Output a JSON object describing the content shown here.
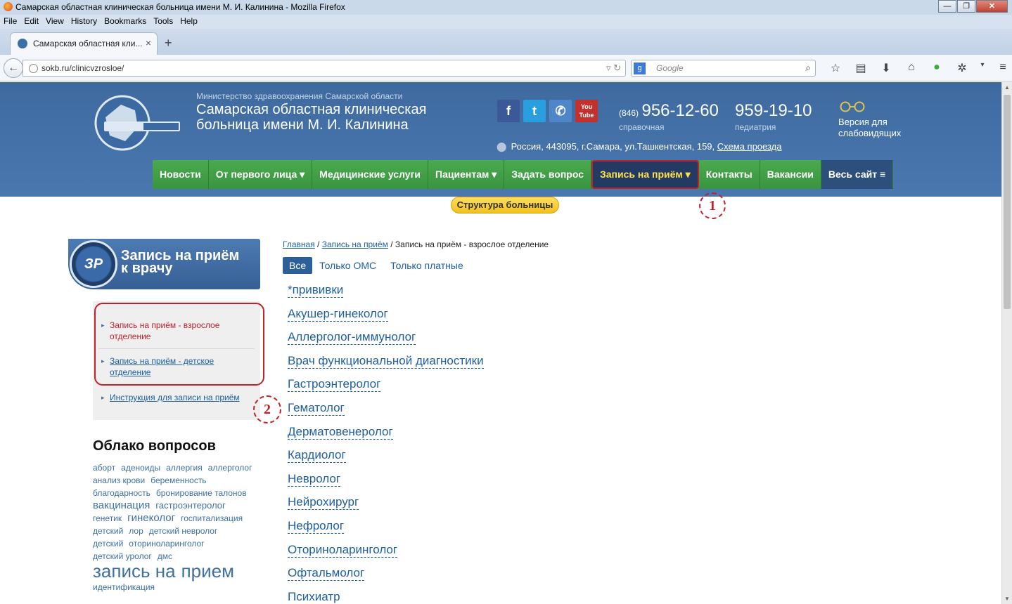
{
  "browser": {
    "window_title": "Самарская областная клиническая больница имени М. И. Калинина - Mozilla Firefox",
    "menu": [
      "File",
      "Edit",
      "View",
      "History",
      "Bookmarks",
      "Tools",
      "Help"
    ],
    "tab_title": "Самарская областная кли...",
    "tab_close": "×",
    "new_tab": "+",
    "url": "sokb.ru/clinicvzrosloe/",
    "search_placeholder": "Google",
    "window_controls": [
      "—",
      "❐",
      "✕"
    ]
  },
  "header": {
    "ministry": "Министерство здравоохранения Самарской области",
    "hospital_name": "Самарская областная клиническая больница имени М. И. Калинина",
    "social": [
      "facebook-icon",
      "twitter-icon",
      "vk-icon",
      "youtube-icon"
    ],
    "phone1": {
      "code": "(846)",
      "number": "956-12-60",
      "caption": "справочная"
    },
    "phone2": {
      "number": "959-19-10",
      "caption": "педиатрия"
    },
    "vision_version": "Версия для слабовидящих",
    "address": "Россия, 443095, г.Самара, ул.Ташкентская, 159,",
    "route_link": "Схема проезда"
  },
  "nav": {
    "items": [
      "Новости",
      "От первого лица ▾",
      "Медицинские услуги",
      "Пациентам ▾",
      "Задать вопрос",
      "Запись на приём ▾",
      "Контакты",
      "Вакансии",
      "Весь сайт ≡"
    ],
    "active_index": 5,
    "structure_button": "Структура больницы"
  },
  "annotations": {
    "mark1": "1",
    "mark2": "2"
  },
  "sidebar": {
    "banner_badge": "ЗР",
    "banner_title_line1": "Запись на приём",
    "banner_title_line2": "к врачу",
    "links": [
      "Запись на приём - взрослое отделение",
      "Запись на приём - детское отделение",
      "Инструкция для записи на приём"
    ],
    "cloud_title": "Облако вопросов",
    "cloud_tags": [
      {
        "t": "аборт",
        "s": 12
      },
      {
        "t": "аденоиды",
        "s": 12
      },
      {
        "t": "аллергия",
        "s": 12
      },
      {
        "t": "аллерголог",
        "s": 12
      },
      {
        "t": "анализ крови",
        "s": 12
      },
      {
        "t": "беременность",
        "s": 12
      },
      {
        "t": "благодарность",
        "s": 12
      },
      {
        "t": "бронирование талонов",
        "s": 12
      },
      {
        "t": "вакцинация",
        "s": 15
      },
      {
        "t": "гастроэнтеролог",
        "s": 13
      },
      {
        "t": "генетик",
        "s": 12
      },
      {
        "t": "гинеколог",
        "s": 15
      },
      {
        "t": "госпитализация",
        "s": 12
      },
      {
        "t": "детский",
        "s": 12
      },
      {
        "t": "лор",
        "s": 12
      },
      {
        "t": "детский невролог",
        "s": 12
      },
      {
        "t": "детский",
        "s": 12
      },
      {
        "t": "оториноларинголог",
        "s": 12
      },
      {
        "t": "детский уролог",
        "s": 12
      },
      {
        "t": "дмс",
        "s": 12
      },
      {
        "t": "запись на",
        "s": 26
      },
      {
        "t": "прием",
        "s": 26
      },
      {
        "t": "идентификация",
        "s": 12
      }
    ]
  },
  "content": {
    "breadcrumb_home": "Главная",
    "breadcrumb_parent": "Запись на приём",
    "breadcrumb_sep": "/",
    "breadcrumb_current": "Запись на приём - взрослое отделение",
    "filters": [
      "Все",
      "Только ОМС",
      "Только платные"
    ],
    "specialists": [
      "*прививки",
      "Акушер-гинеколог",
      "Аллерголог-иммунолог",
      "Врач функциональной диагностики",
      "Гастроэнтеролог",
      "Гематолог",
      "Дерматовенеролог",
      "Кардиолог",
      "Невролог",
      "Нейрохирург",
      "Нефролог",
      "Оториноларинголог",
      "Офтальмолог",
      "Психиатр"
    ]
  }
}
